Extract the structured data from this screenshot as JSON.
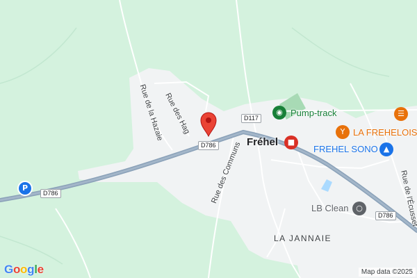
{
  "map": {
    "pin": {
      "name": "map-pin",
      "color": "#ea4335"
    },
    "road_shields": [
      {
        "name": "road-shield-d786-center",
        "text": "D786"
      },
      {
        "name": "road-shield-d786-west",
        "text": "D786"
      },
      {
        "name": "road-shield-d117",
        "text": "D117"
      },
      {
        "name": "road-shield-d786-east",
        "text": "D786"
      }
    ],
    "street_labels": {
      "rue_des_hag": "Rue des Hag",
      "rue_de_la_hazaie": "Rue de la Hazaie",
      "rue_des_communs": "Rue des Communs",
      "rue_de_l_ecusset": "Rue de l'Écusset"
    },
    "place_labels": {
      "town": "Fréhel",
      "district": "LA JANNAIE"
    },
    "pois": [
      {
        "name": "poi-pump-track",
        "label": "Pump-track",
        "icon": "park-icon",
        "color": "#188038"
      },
      {
        "name": "poi-la-frehelois",
        "label": "LA FREHELOIS",
        "icon": "bar-icon",
        "color": "#e8710a"
      },
      {
        "name": "poi-frehel-sono",
        "label": "FREHEL SONO",
        "icon": "shopping-icon",
        "color": "#1a73e8"
      },
      {
        "name": "poi-lb-clean",
        "label": "LB Clean",
        "icon": "service-icon",
        "color": "#5f6368"
      },
      {
        "name": "poi-restaurant",
        "label": "",
        "icon": "restaurant-icon",
        "color": "#e8710a"
      },
      {
        "name": "poi-shop",
        "label": "",
        "icon": "gift-shop-icon",
        "color": "#d93025"
      },
      {
        "name": "poi-parking",
        "label": "",
        "icon": "parking-icon",
        "color": "#1a73e8"
      }
    ],
    "attribution": "Map data ©2025",
    "logo": "Google"
  }
}
